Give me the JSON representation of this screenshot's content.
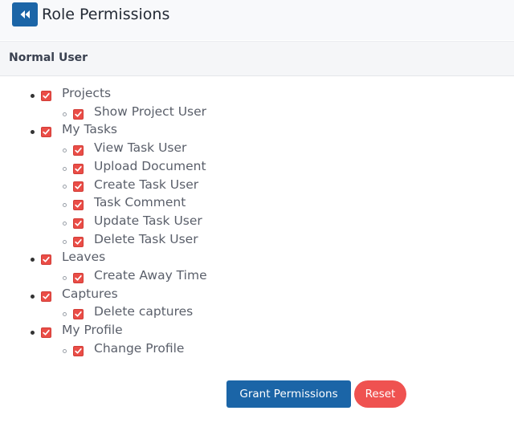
{
  "header": {
    "title": "Role Permissions",
    "back_icon": "double-chevron-left-icon"
  },
  "role": {
    "name": "Normal User"
  },
  "permissions": [
    {
      "label": "Projects",
      "checked": true,
      "children": [
        {
          "label": "Show Project User",
          "checked": true
        }
      ]
    },
    {
      "label": "My Tasks",
      "checked": true,
      "children": [
        {
          "label": "View Task User",
          "checked": true
        },
        {
          "label": "Upload Document",
          "checked": true
        },
        {
          "label": "Create Task User",
          "checked": true
        },
        {
          "label": "Task Comment",
          "checked": true
        },
        {
          "label": "Update Task User",
          "checked": true
        },
        {
          "label": "Delete Task User",
          "checked": true
        }
      ]
    },
    {
      "label": "Leaves",
      "checked": true,
      "children": [
        {
          "label": "Create Away Time",
          "checked": true
        }
      ]
    },
    {
      "label": "Captures",
      "checked": true,
      "children": [
        {
          "label": "Delete captures",
          "checked": true
        }
      ]
    },
    {
      "label": "My Profile",
      "checked": true,
      "children": [
        {
          "label": "Change Profile",
          "checked": true
        }
      ]
    }
  ],
  "actions": {
    "grant_label": "Grant Permissions",
    "reset_label": "Reset"
  },
  "colors": {
    "primary": "#1b65a7",
    "danger": "#ef5250",
    "checkbox": "#ea4d47"
  }
}
